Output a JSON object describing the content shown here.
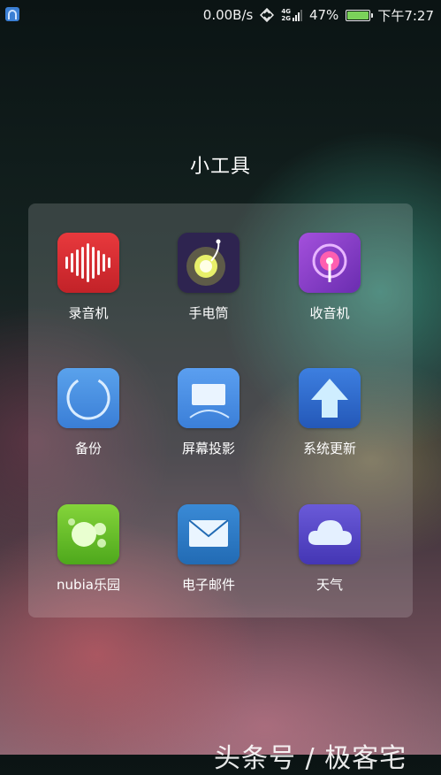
{
  "status_bar": {
    "net_speed": "0.00B/s",
    "net_type_top": "4G",
    "net_type_bottom": "2G",
    "signal_level": 0.8,
    "battery_percent_text": "47%",
    "battery_level": 1.0,
    "battery_color": "#7bd25a",
    "time": "下午7:27",
    "icons": [
      "app-notification-icon",
      "sync-icon",
      "signal-icon",
      "battery-icon"
    ]
  },
  "folder": {
    "title": "小工具",
    "apps": [
      {
        "label": "录音机",
        "icon": "sound-recorder-icon",
        "color": "#d92f35"
      },
      {
        "label": "手电筒",
        "icon": "flashlight-icon",
        "color": "#3a2a5e"
      },
      {
        "label": "收音机",
        "icon": "radio-icon",
        "color": "#8a3fc7"
      },
      {
        "label": "备份",
        "icon": "backup-icon",
        "color": "#4a8fe0"
      },
      {
        "label": "屏幕投影",
        "icon": "screen-projection-icon",
        "color": "#4b8ee2"
      },
      {
        "label": "系统更新",
        "icon": "system-update-icon",
        "color": "#2f6fd2"
      },
      {
        "label": "nubia乐园",
        "icon": "nubia-park-icon",
        "color": "#6cc22c"
      },
      {
        "label": "电子邮件",
        "icon": "email-icon",
        "color": "#2e7cc8"
      },
      {
        "label": "天气",
        "icon": "weather-icon",
        "color": "#5a4fc9"
      }
    ]
  },
  "watermark": "头条号 / 极客宅"
}
